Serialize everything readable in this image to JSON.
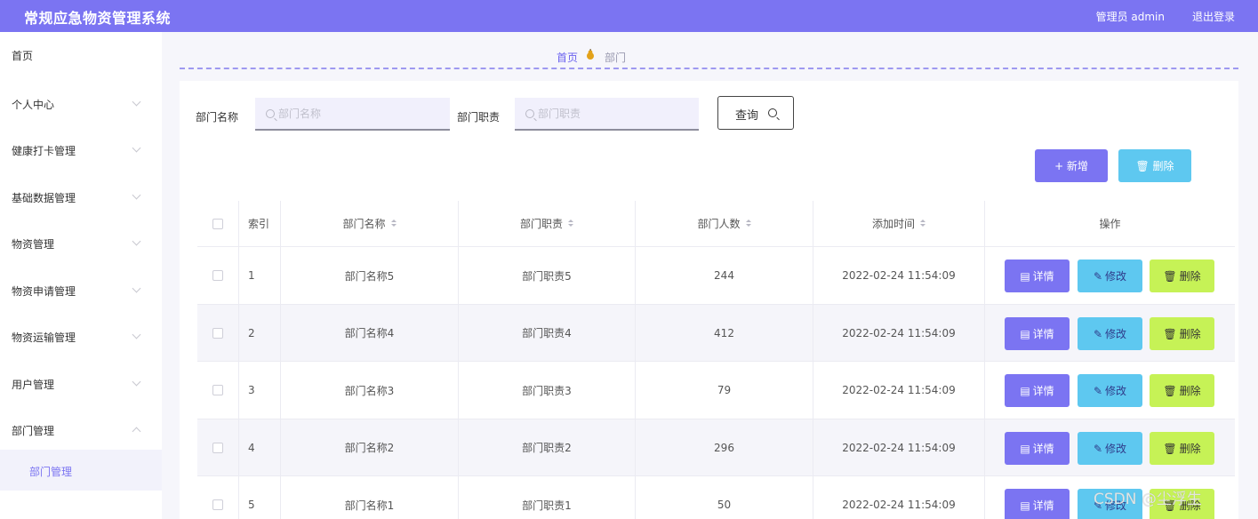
{
  "header": {
    "app_title": "常规应急物资管理系统",
    "user_info": "管理员 admin",
    "logout": "退出登录",
    "bg_color": "#7b74f2"
  },
  "sidebar": {
    "items": [
      {
        "label": "首页"
      },
      {
        "label": "个人中心"
      },
      {
        "label": "健康打卡管理"
      },
      {
        "label": "基础数据管理"
      },
      {
        "label": "物资管理"
      },
      {
        "label": "物资申请管理"
      },
      {
        "label": "物资运输管理"
      },
      {
        "label": "用户管理"
      },
      {
        "label": "部门管理"
      }
    ],
    "sub_item": "部门管理"
  },
  "breadcrumb": {
    "home": "首页",
    "current": "部门"
  },
  "search": {
    "name_label": "部门名称",
    "name_placeholder": "部门名称",
    "duty_label": "部门职责",
    "duty_placeholder": "部门职责",
    "query_label": "查询"
  },
  "toolbar": {
    "add_label": "+ 新增",
    "delete_label": "删除"
  },
  "table": {
    "columns": [
      "索引",
      "部门名称",
      "部门职责",
      "部门人数",
      "添加时间",
      "操作"
    ],
    "rows": [
      {
        "index": "1",
        "name": "部门名称5",
        "duty": "部门职责5",
        "count": "244",
        "time": "2022-02-24 11:54:09"
      },
      {
        "index": "2",
        "name": "部门名称4",
        "duty": "部门职责4",
        "count": "412",
        "time": "2022-02-24 11:54:09"
      },
      {
        "index": "3",
        "name": "部门名称3",
        "duty": "部门职责3",
        "count": "79",
        "time": "2022-02-24 11:54:09"
      },
      {
        "index": "4",
        "name": "部门名称2",
        "duty": "部门职责2",
        "count": "296",
        "time": "2022-02-24 11:54:09"
      },
      {
        "index": "5",
        "name": "部门名称1",
        "duty": "部门职责1",
        "count": "50",
        "time": "2022-02-24 11:54:09"
      }
    ],
    "actions": {
      "detail": "详情",
      "edit": "修改",
      "remove": "删除"
    }
  },
  "watermark": "CSDN @尘浮生"
}
